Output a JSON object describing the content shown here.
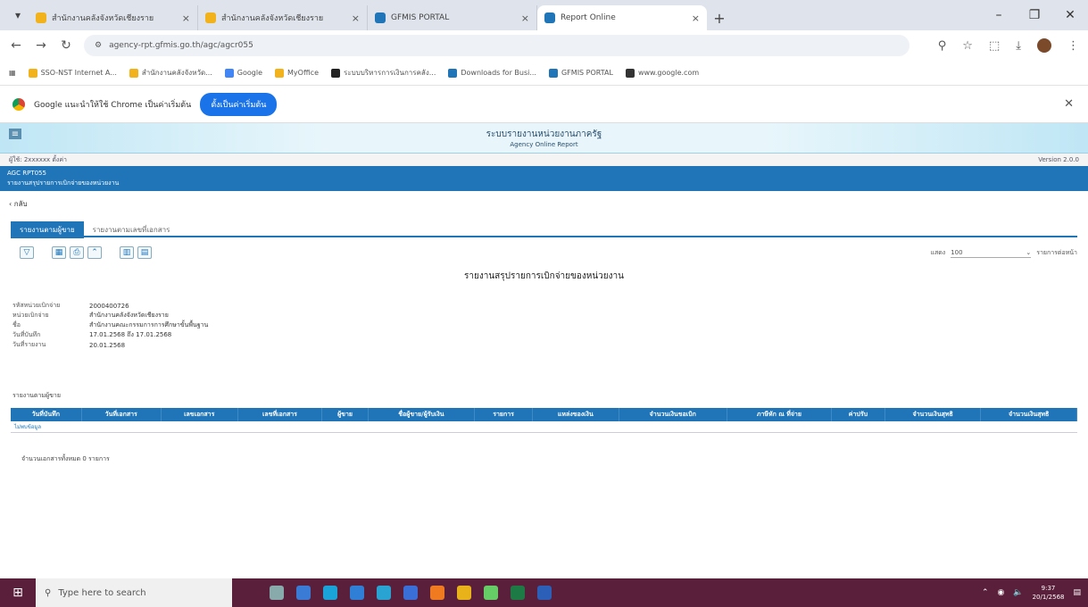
{
  "browser": {
    "tabs": [
      {
        "label": "สำนักงานคลังจังหวัดเชียงราย",
        "active": false,
        "color": "#f2b21b"
      },
      {
        "label": "สำนักงานคลังจังหวัดเชียงราย",
        "active": false,
        "color": "#f2b21b"
      },
      {
        "label": "GFMIS PORTAL",
        "active": false,
        "color": "#1f75b8"
      },
      {
        "label": "Report Online",
        "active": true,
        "color": "#1f75b8"
      }
    ],
    "new_tab": "+",
    "url": "agency-rpt.gfmis.go.th/agc/agcr055",
    "bookmarks": [
      {
        "label": "SSO-NST Internet A...",
        "color": "#f2b21b"
      },
      {
        "label": "สำนักงานคลังจังหวัด...",
        "color": "#f2b21b"
      },
      {
        "label": "Google",
        "color": "#4285f4"
      },
      {
        "label": "MyOffice",
        "color": "#f2b21b"
      },
      {
        "label": "ระบบบริหารการเงินการคลัง...",
        "color": "#222"
      },
      {
        "label": "Downloads for Busi...",
        "color": "#1f75b8"
      },
      {
        "label": "GFMIS PORTAL",
        "color": "#1f75b8"
      },
      {
        "label": "www.google.com",
        "color": "#333"
      }
    ],
    "infobar": {
      "message": "Google แนะนำให้ใช้ Chrome เป็นค่าเริ่มต้น",
      "button": "ตั้งเป็นค่าเริ่มต้น"
    }
  },
  "site": {
    "title": "ระบบรายงานหน่วยงานภาครัฐ",
    "subtitle": "Agency Online Report",
    "userline_left": "ผู้ใช้: 2xxxxxx  ตั้งค่า",
    "userline_right": "Version 2.0.0",
    "section_code": "AGC RPT055",
    "section_name": "รายงานสรุปรายการเบิกจ่ายของหน่วยงาน",
    "back": "กลับ"
  },
  "subtabs": [
    "รายงานตามผู้ขาย",
    "รายงานตามเลขที่เอกสาร"
  ],
  "rows_selector": {
    "label": "แสดง",
    "value": "100",
    "suffix": "รายการต่อหน้า"
  },
  "report": {
    "title": "รายงานสรุปรายการเบิกจ่ายของหน่วยงาน",
    "meta": [
      {
        "key": "รหัสหน่วยเบิกจ่าย",
        "value": "2000400726"
      },
      {
        "key": "หน่วยเบิกจ่าย",
        "value": "สำนักงานคลังจังหวัดเชียงราย"
      },
      {
        "key": "ชื่อ",
        "value": "สำนักงานคณะกรรมการการศึกษาขั้นพื้นฐาน"
      },
      {
        "key": "วันที่บันทึก",
        "value": "17.01.2568 ถึง 17.01.2568"
      },
      {
        "key": "วันที่รายงาน",
        "value": "20.01.2568"
      }
    ],
    "table_label": "รายงานตามผู้ขาย",
    "columns": [
      "วันที่บันทึก",
      "วันที่เอกสาร",
      "เลขเอกสาร",
      "เลขที่เอกสาร",
      "ผู้ขาย",
      "ชื่อผู้ขาย/ผู้รับเงิน",
      "รายการ",
      "แหล่งของเงิน",
      "จำนวนเงินขอเบิก",
      "ภาษีหัก ณ ที่จ่าย",
      "ค่าปรับ",
      "จำนวนเงินสุทธิ",
      "จำนวนเงินสุทธิ"
    ],
    "empty_row": "ไม่พบข้อมูล",
    "footnote": "จำนวนเอกสารทั้งหมด 0 รายการ"
  },
  "taskbar": {
    "search_placeholder": "Type here to search",
    "time": "9:37",
    "date": "20/1/2568"
  }
}
